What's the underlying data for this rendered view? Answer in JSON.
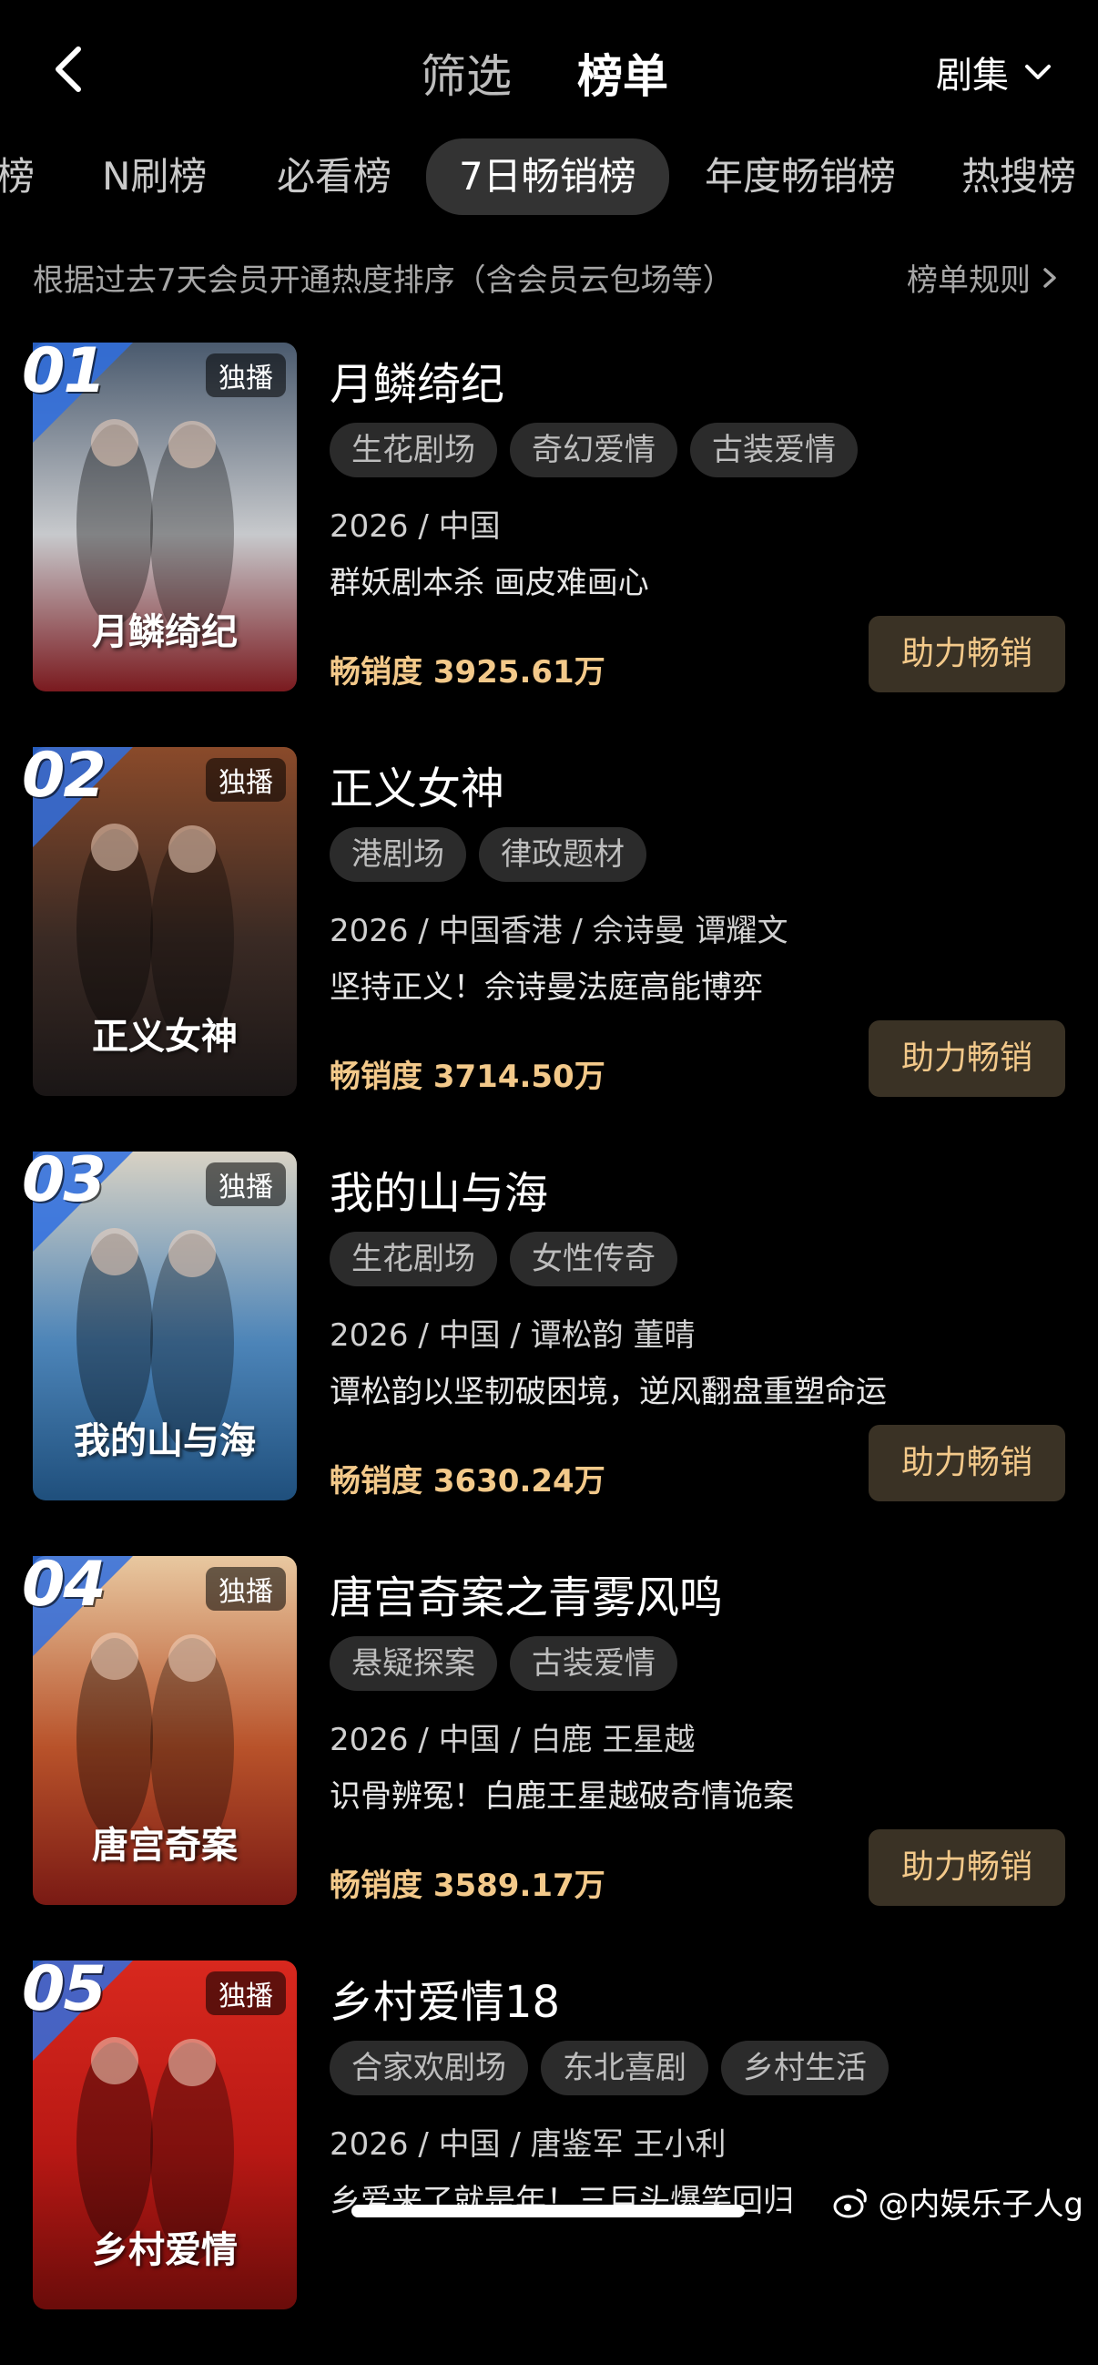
{
  "header": {
    "filter_label": "筛选",
    "rank_label": "榜单",
    "genre_label": "剧集"
  },
  "chart_tabs": [
    {
      "label": "榜",
      "active": false
    },
    {
      "label": "N刷榜",
      "active": false
    },
    {
      "label": "必看榜",
      "active": false
    },
    {
      "label": "7日畅销榜",
      "active": true
    },
    {
      "label": "年度畅销榜",
      "active": false
    },
    {
      "label": "热搜榜",
      "active": false
    }
  ],
  "description": "根据过去7天会员开通热度排序（含会员云包场等）",
  "rules_label": "榜单规则",
  "exclusive_label": "独播",
  "boost_label": "助力畅销",
  "items": [
    {
      "rank": "01",
      "title": "月鳞绮纪",
      "tags": [
        "生花剧场",
        "奇幻爱情",
        "古装爱情"
      ],
      "meta": "2026 / 中国",
      "blurb": "群妖剧本杀 画皮难画心",
      "sales": "畅销度 3925.61万",
      "poster_colors": [
        "#4a5a6e",
        "#c7c9cc",
        "#7a1a1f"
      ],
      "poster_text": "月鳞绮纪"
    },
    {
      "rank": "02",
      "title": "正义女神",
      "tags": [
        "港剧场",
        "律政题材"
      ],
      "meta": "2026 / 中国香港 / 佘诗曼 谭耀文",
      "blurb": "坚持正义！佘诗曼法庭高能博弈",
      "sales": "畅销度 3714.50万",
      "poster_colors": [
        "#8a4a2a",
        "#3a2a24",
        "#1a1616"
      ],
      "poster_text": "正义女神"
    },
    {
      "rank": "03",
      "title": "我的山与海",
      "tags": [
        "生花剧场",
        "女性传奇"
      ],
      "meta": "2026 / 中国 / 谭松韵 董晴",
      "blurb": "谭松韵以坚韧破困境，逆风翻盘重塑命运",
      "sales": "畅销度 3630.24万",
      "poster_colors": [
        "#d8d2c4",
        "#4c84b8",
        "#1f4f7c"
      ],
      "poster_text": "我的山与海"
    },
    {
      "rank": "04",
      "title": "唐宫奇案之青雾风鸣",
      "tags": [
        "悬疑探案",
        "古装爱情"
      ],
      "meta": "2026 / 中国 / 白鹿 王星越",
      "blurb": "识骨辨冤！白鹿王星越破奇情诡案",
      "sales": "畅销度 3589.17万",
      "poster_colors": [
        "#e8c8a0",
        "#b8522a",
        "#7a1a14"
      ],
      "poster_text": "唐宫奇案"
    },
    {
      "rank": "05",
      "title": "乡村爱情18",
      "tags": [
        "合家欢剧场",
        "东北喜剧",
        "乡村生活"
      ],
      "meta": "2026 / 中国 / 唐鉴军 王小利",
      "blurb": "乡爱来了就是年！三巨头爆笑回归",
      "sales": "",
      "poster_colors": [
        "#d8281e",
        "#b81814",
        "#6a0c0a"
      ],
      "poster_text": "乡村爱情"
    }
  ],
  "watermark": "@内娱乐子人g"
}
